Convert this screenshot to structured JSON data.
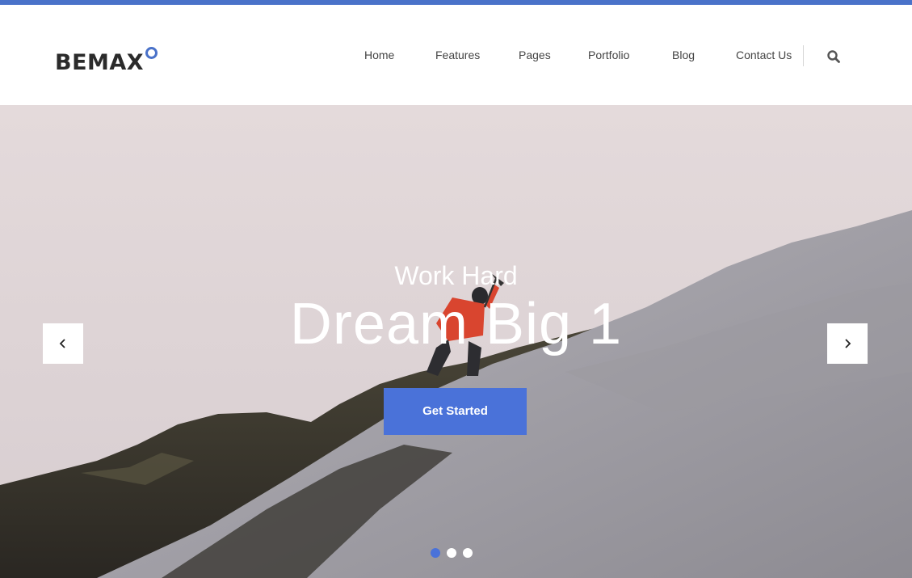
{
  "brand": {
    "name": "BEMAX",
    "accent_color": "#4a72c9"
  },
  "nav": {
    "items": [
      {
        "label": "Home"
      },
      {
        "label": "Features"
      },
      {
        "label": "Pages"
      },
      {
        "label": "Portfolio"
      },
      {
        "label": "Blog"
      },
      {
        "label": "Contact Us"
      }
    ],
    "search_icon": "search-icon"
  },
  "hero": {
    "subtitle": "Work Hard",
    "title": "Dream Big 1",
    "cta_label": "Get Started",
    "cta_color": "#4a72d9",
    "prev_icon": "chevron-left-icon",
    "next_icon": "chevron-right-icon",
    "slides_total": 3,
    "active_slide": 1
  }
}
